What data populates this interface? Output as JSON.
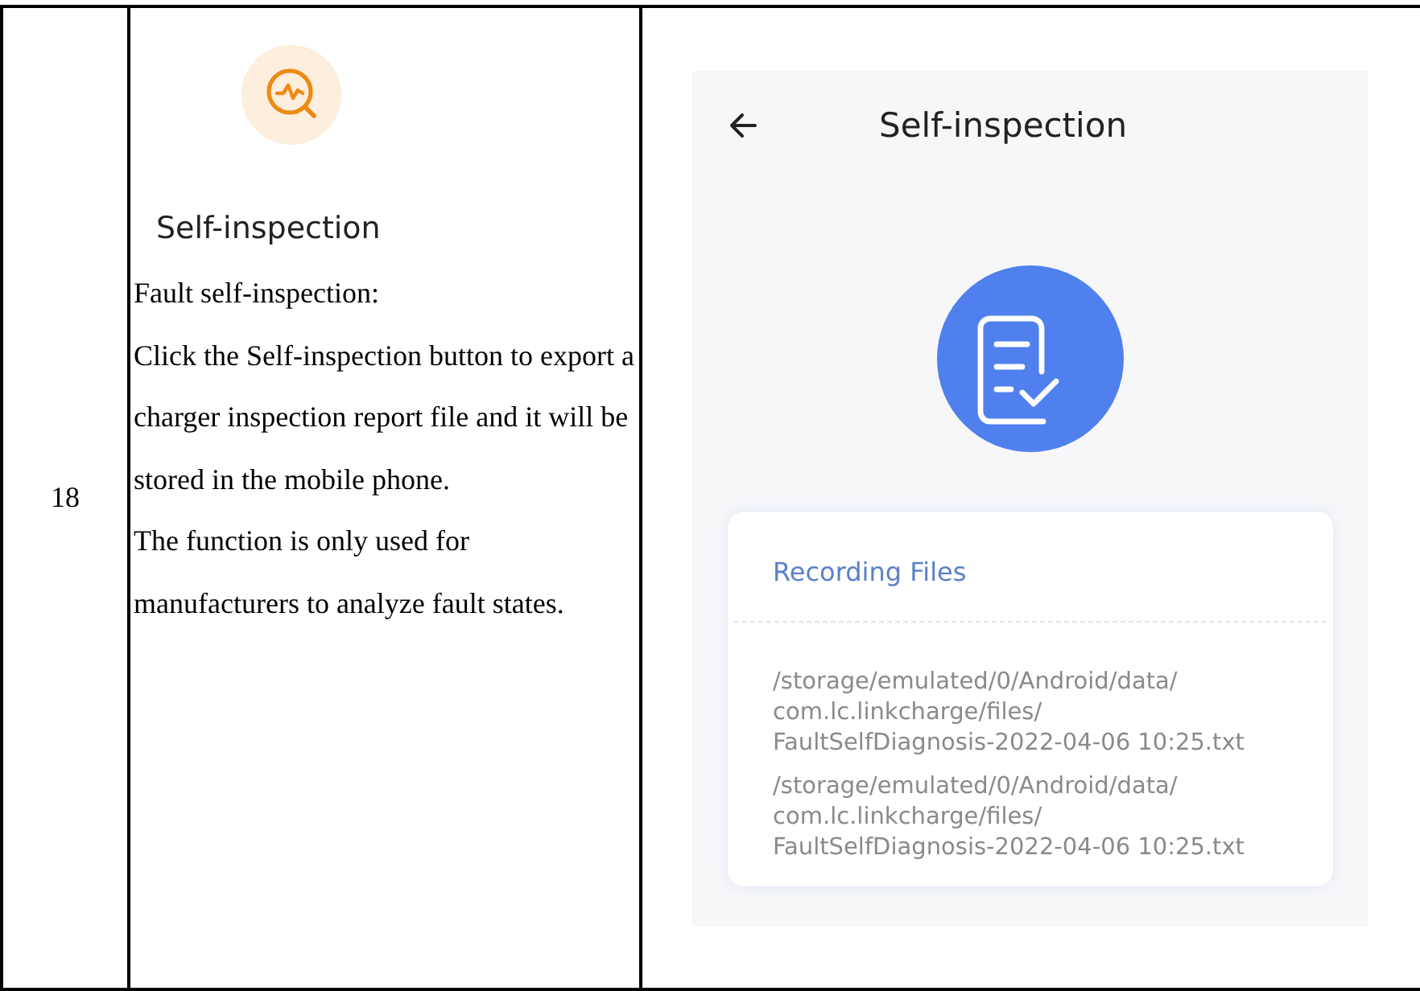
{
  "row": {
    "number": "18",
    "feature": {
      "label": "Self-inspection"
    },
    "description": [
      "Fault self-inspection:",
      "Click the Self-inspection button to export a charger inspection report file and it will be stored in the mobile phone.",
      "The function is only used for manufacturers to analyze fault states."
    ],
    "screen": {
      "title": "Self-inspection",
      "card_title": "Recording Files",
      "files": [
        "/storage/emulated/0/Android/data/\ncom.lc.linkcharge/files/\nFaultSelfDiagnosis-2022-04-06 10:25.txt",
        "/storage/emulated/0/Android/data/\ncom.lc.linkcharge/files/\nFaultSelfDiagnosis-2022-04-06 10:25.txt"
      ]
    }
  }
}
